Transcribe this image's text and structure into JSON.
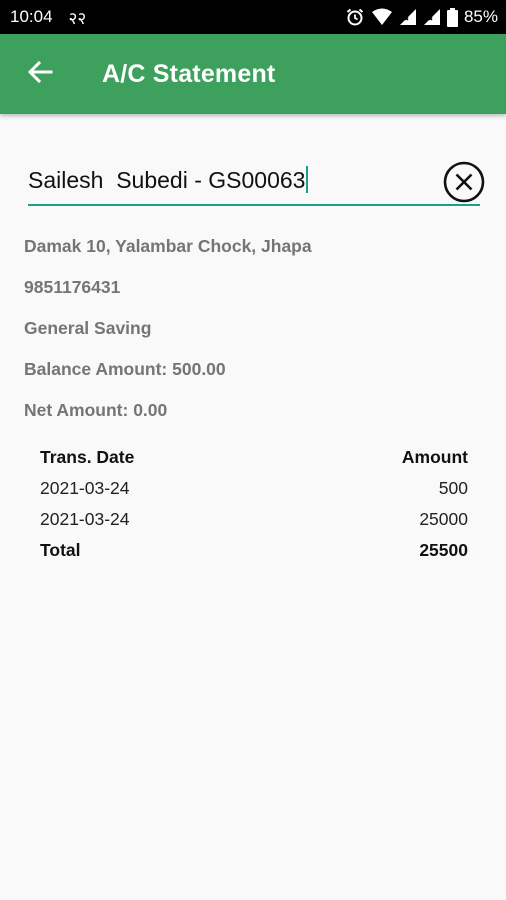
{
  "status_bar": {
    "time": "10:04",
    "notification_text": "२२",
    "battery_percent": "85%"
  },
  "app_bar": {
    "title": "A/C Statement",
    "background_color": "#3da05d"
  },
  "search": {
    "value": "Sailesh  Subedi - GS00063",
    "accent_color": "#1f9d8b"
  },
  "account": {
    "address": "Damak 10, Yalambar Chock, Jhapa",
    "phone": "9851176431",
    "account_type": "General Saving",
    "balance": "Balance Amount: 500.00",
    "net": "Net Amount: 0.00"
  },
  "table": {
    "headers": {
      "date": "Trans. Date",
      "amount": "Amount"
    },
    "rows": [
      {
        "date": "2021-03-24",
        "amount": "500"
      },
      {
        "date": "2021-03-24",
        "amount": "25000"
      }
    ],
    "total": {
      "label": "Total",
      "amount": "25500"
    }
  },
  "icons": {
    "back": "arrow-back-icon",
    "clear": "close-circle-icon",
    "alarm": "alarm-icon",
    "wifi": "wifi-icon",
    "signal": "signal-icon",
    "battery": "battery-icon"
  }
}
